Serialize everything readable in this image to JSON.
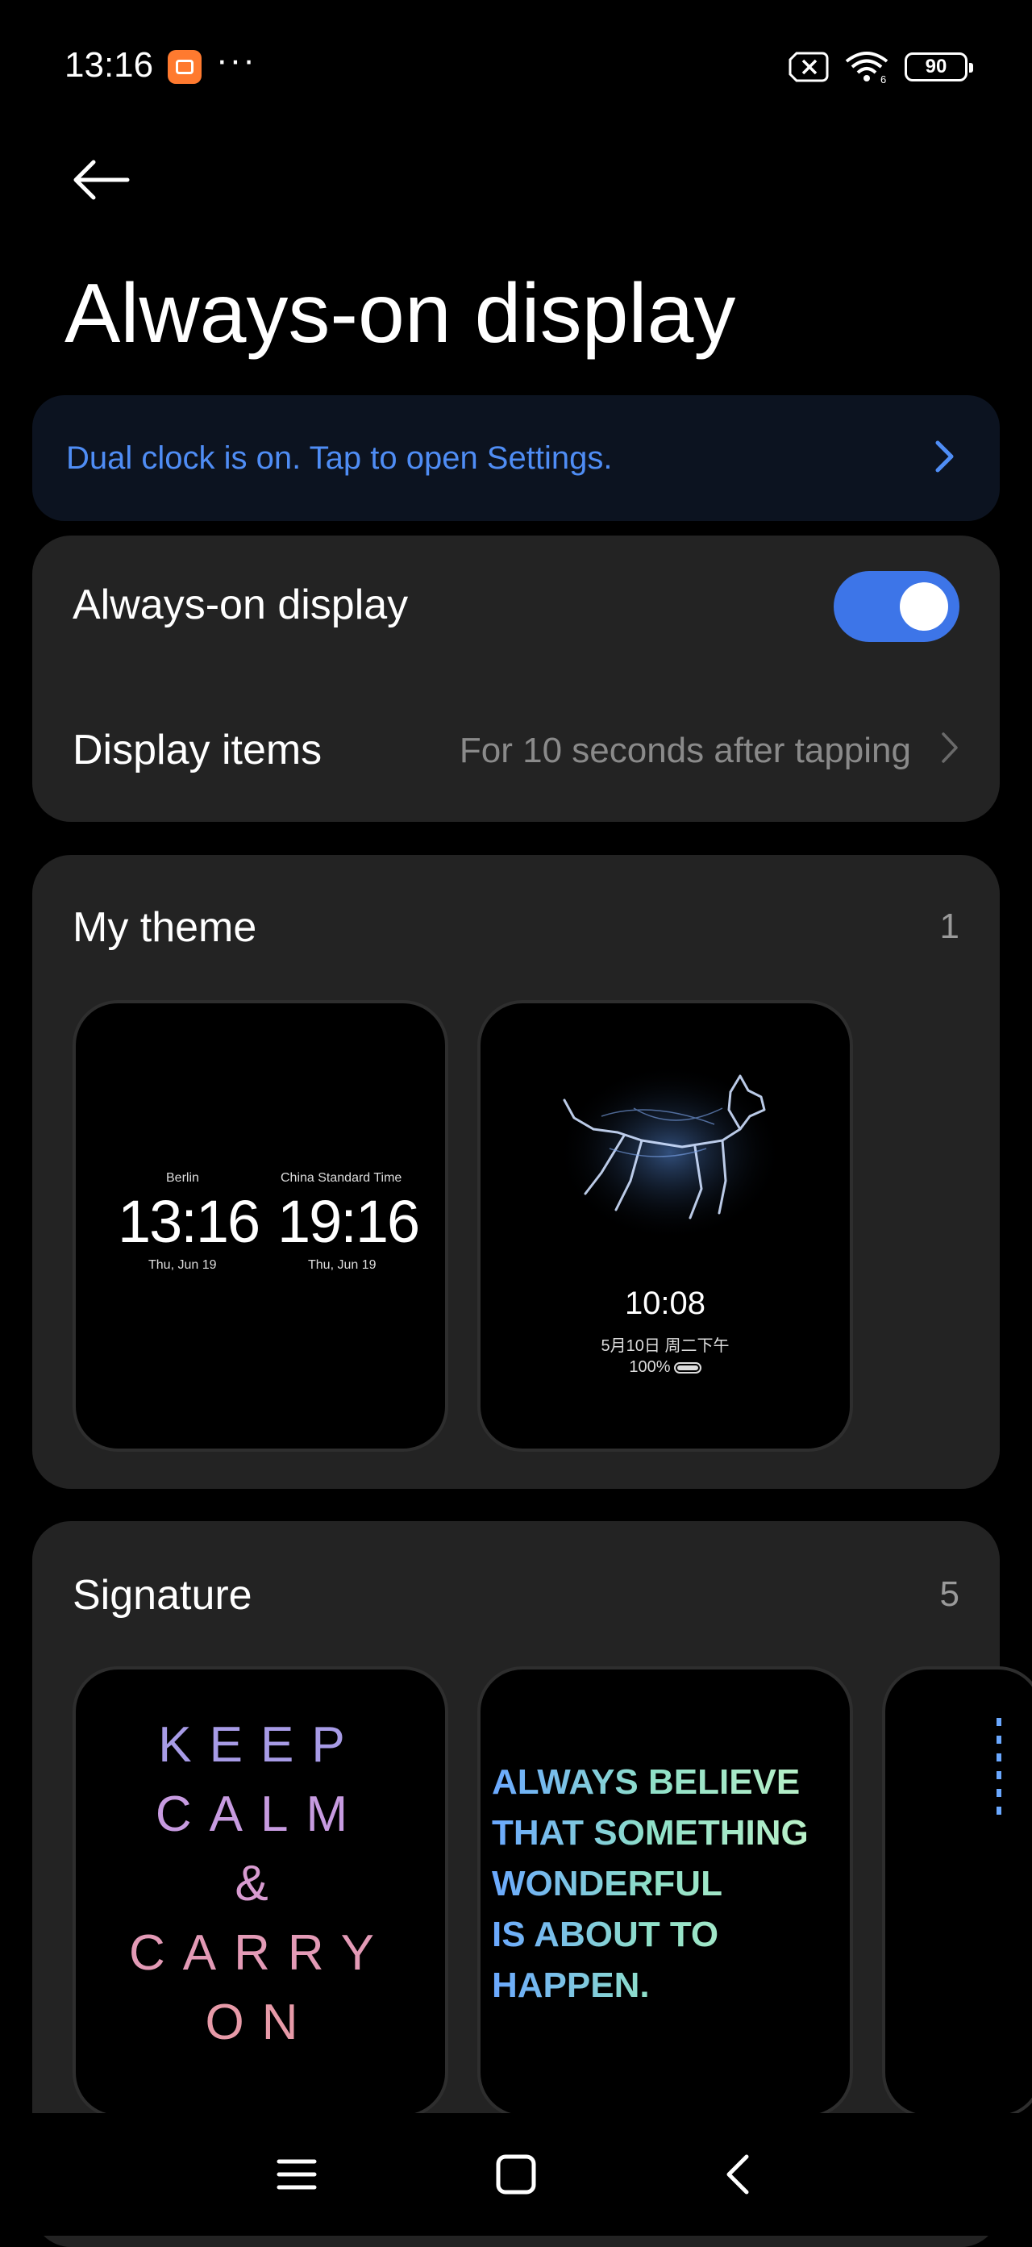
{
  "status": {
    "time": "13:16",
    "dots": "···",
    "battery": "90"
  },
  "header": {
    "title": "Always-on display"
  },
  "banner": {
    "text": "Dual clock is on. Tap to open Settings."
  },
  "settings": {
    "aod_label": "Always-on display",
    "aod_enabled": true,
    "display_items_label": "Display items",
    "display_items_value": "For 10 seconds after tapping"
  },
  "my_theme": {
    "title": "My theme",
    "count": "1",
    "dual_clock": {
      "left_city": "Berlin",
      "left_time": "13:16",
      "left_date": "Thu, Jun 19",
      "right_city": "China Standard Time",
      "right_time": "19:16",
      "right_date": "Thu, Jun 19"
    },
    "dog_theme": {
      "time": "10:08",
      "date": "5月10日 周二下午",
      "battery": "100%"
    }
  },
  "signature": {
    "title": "Signature",
    "count": "5",
    "keep_calm": [
      "KEEP",
      "CALM",
      "&",
      "CARRY",
      "ON"
    ],
    "always_believe": [
      "ALWAYS BELIEVE",
      "THAT SOMETHING",
      "WONDERFUL",
      "IS ABOUT TO",
      "HAPPEN."
    ]
  },
  "colors": {
    "accent": "#3d75e8",
    "banner_text": "#4f8df5",
    "card": "#232323"
  }
}
